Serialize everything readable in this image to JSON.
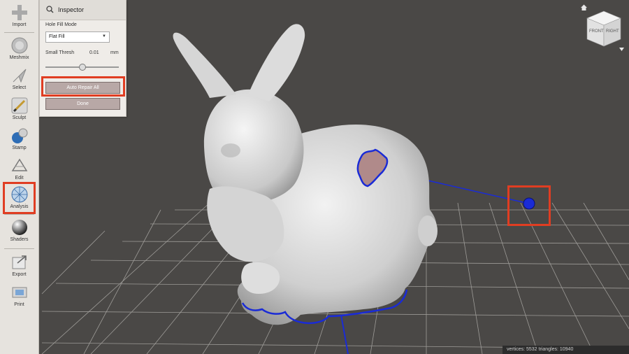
{
  "toolbar": {
    "items": [
      {
        "label": "Import",
        "icon": "plus-icon"
      },
      {
        "label": "Meshmix",
        "icon": "meshmix-icon"
      },
      {
        "label": "Select",
        "icon": "select-arrow-icon"
      },
      {
        "label": "Sculpt",
        "icon": "brush-icon"
      },
      {
        "label": "Stamp",
        "icon": "stamp-icon"
      },
      {
        "label": "Edit",
        "icon": "edit-icon"
      },
      {
        "label": "Analysis",
        "icon": "analysis-icon"
      },
      {
        "label": "Shaders",
        "icon": "sphere-icon"
      },
      {
        "label": "Export",
        "icon": "export-icon"
      },
      {
        "label": "Print",
        "icon": "print-icon"
      }
    ]
  },
  "inspector": {
    "title": "Inspector",
    "hole_fill_label": "Hole Fill Mode",
    "hole_fill_value": "Flat Fill",
    "small_thresh_label": "Small Thresh",
    "small_thresh_value": "0.01",
    "small_thresh_unit": "mm",
    "small_thresh_slider": 0.5,
    "auto_repair_label": "Auto Repair All",
    "done_label": "Done"
  },
  "viewcube": {
    "front_label": "FRONT",
    "right_label": "RIGHT"
  },
  "status": {
    "text": "vertices: 5532 triangles: 10940"
  },
  "colors": {
    "highlight": "#e03d22",
    "hole_outline": "#1a2bd6",
    "background": "#4a4846"
  }
}
